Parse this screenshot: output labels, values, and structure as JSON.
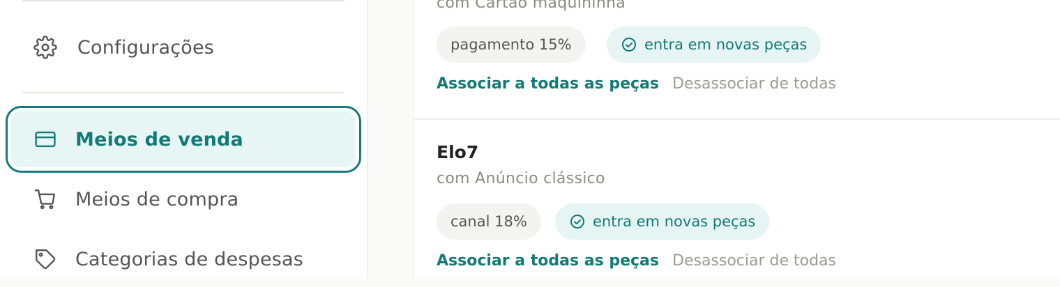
{
  "sidebar": {
    "items": [
      {
        "label": "Configurações",
        "icon": "gear-icon"
      },
      {
        "label": "Meios de venda",
        "icon": "credit-card-icon",
        "active": true
      },
      {
        "label": "Meios de compra",
        "icon": "shopping-cart-icon"
      },
      {
        "label": "Categorias de despesas",
        "icon": "tag-icon"
      }
    ]
  },
  "cards": [
    {
      "subtitle": "com Cartão maquininha",
      "fee_badge": "pagamento 15%",
      "status_badge": "entra em novas peças",
      "associate_label": "Associar a todas as peças",
      "dissociate_label": "Desassociar de todas"
    },
    {
      "title": "Elo7",
      "subtitle": "com Anúncio clássico",
      "fee_badge": "canal 18%",
      "status_badge": "entra em novas peças",
      "associate_label": "Associar a todas as peças",
      "dissociate_label": "Desassociar de todas"
    }
  ],
  "colors": {
    "accent": "#137a76",
    "accent_bg": "#e8f5f5",
    "muted": "#8a8a86"
  }
}
